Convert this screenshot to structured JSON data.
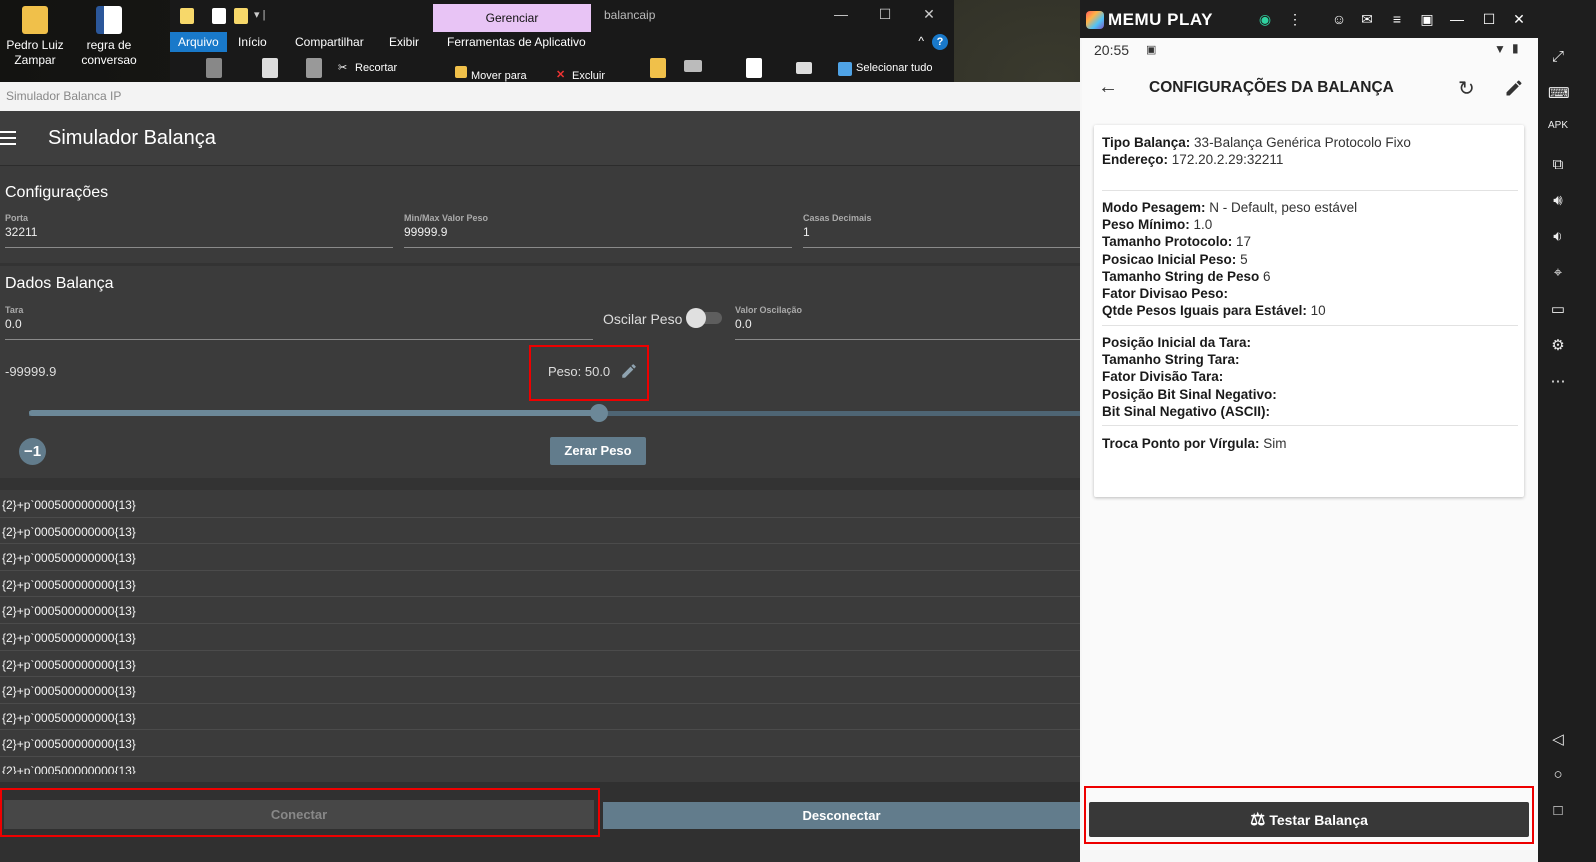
{
  "desktop": {
    "icons": [
      {
        "label_line1": "Pedro Luiz",
        "label_line2": "Zampar"
      },
      {
        "label_line1": "regra de",
        "label_line2": "conversao"
      }
    ]
  },
  "explorer": {
    "contextual_tab": "Gerenciar",
    "window_title": "balancaip",
    "tabs": [
      "Arquivo",
      "Início",
      "Compartilhar",
      "Exibir",
      "Ferramentas de Aplicativo"
    ],
    "commands": {
      "recortar": "Recortar",
      "mover_para": "Mover para",
      "excluir": "Excluir",
      "selecionar_tudo": "Selecionar tudo"
    }
  },
  "simulator": {
    "window_title": "Simulador Balanca IP",
    "app_title": "Simulador Balança",
    "config_title": "Configurações",
    "fields": {
      "porta": {
        "label": "Porta",
        "value": "32211"
      },
      "minmax": {
        "label": "Min/Max Valor Peso",
        "value": "99999.9"
      },
      "casas": {
        "label": "Casas Decimais",
        "value": "1"
      }
    },
    "dados_title": "Dados Balança",
    "tara": {
      "label": "Tara",
      "value": "0.0"
    },
    "oscilar_label": "Oscilar Peso",
    "oscilar_on": false,
    "valor_oscilacao": {
      "label": "Valor Oscilação",
      "value": "0.0"
    },
    "min_label": "-99999.9",
    "peso_label": "Peso: 50.0",
    "slider_fraction": 0.5425,
    "minus_button": "−1",
    "zerar_button": "Zerar Peso",
    "log_lines": [
      "{2}+p`000500000000{13}",
      "{2}+p`000500000000{13}",
      "{2}+p`000500000000{13}",
      "{2}+p`000500000000{13}",
      "{2}+p`000500000000{13}",
      "{2}+p`000500000000{13}",
      "{2}+p`000500000000{13}",
      "{2}+p`000500000000{13}",
      "{2}+p`000500000000{13}",
      "{2}+p`000500000000{13}",
      "{2}+p`000500000000{13}"
    ],
    "conectar_button": "Conectar",
    "desconectar_button": "Desconectar"
  },
  "memu": {
    "brand": "MEMU PLAY",
    "android": {
      "time": "20:55",
      "title": "CONFIGURAÇÕES DA BALANÇA",
      "section1": [
        {
          "key": "Tipo Balança:",
          "value": "33-Balança Genérica Protocolo Fixo"
        },
        {
          "key": "Endereço:",
          "value": "172.20.2.29:32211"
        }
      ],
      "section2": [
        {
          "key": "Modo Pesagem:",
          "value": "N - Default, peso estável"
        },
        {
          "key": "Peso Mínimo:",
          "value": "1.0"
        },
        {
          "key": "Tamanho Protocolo:",
          "value": "17"
        },
        {
          "key": "Posicao Inicial Peso:",
          "value": "5"
        },
        {
          "key": "Tamanho String de Peso",
          "value": "6"
        },
        {
          "key": "Fator Divisao Peso:",
          "value": ""
        },
        {
          "key": "Qtde Pesos Iguais para Estável:",
          "value": "10"
        }
      ],
      "section3": [
        {
          "key": "Posição Inicial da Tara:",
          "value": ""
        },
        {
          "key": "Tamanho String Tara:",
          "value": ""
        },
        {
          "key": "Fator Divisão Tara:",
          "value": ""
        },
        {
          "key": "Posição Bit Sinal Negativo:",
          "value": ""
        },
        {
          "key": "Bit Sinal Negativo (ASCII):",
          "value": ""
        }
      ],
      "section4": [
        {
          "key": "Troca Ponto por Vírgula:",
          "value": "Sim"
        }
      ],
      "testar_button": "Testar Balança"
    }
  }
}
